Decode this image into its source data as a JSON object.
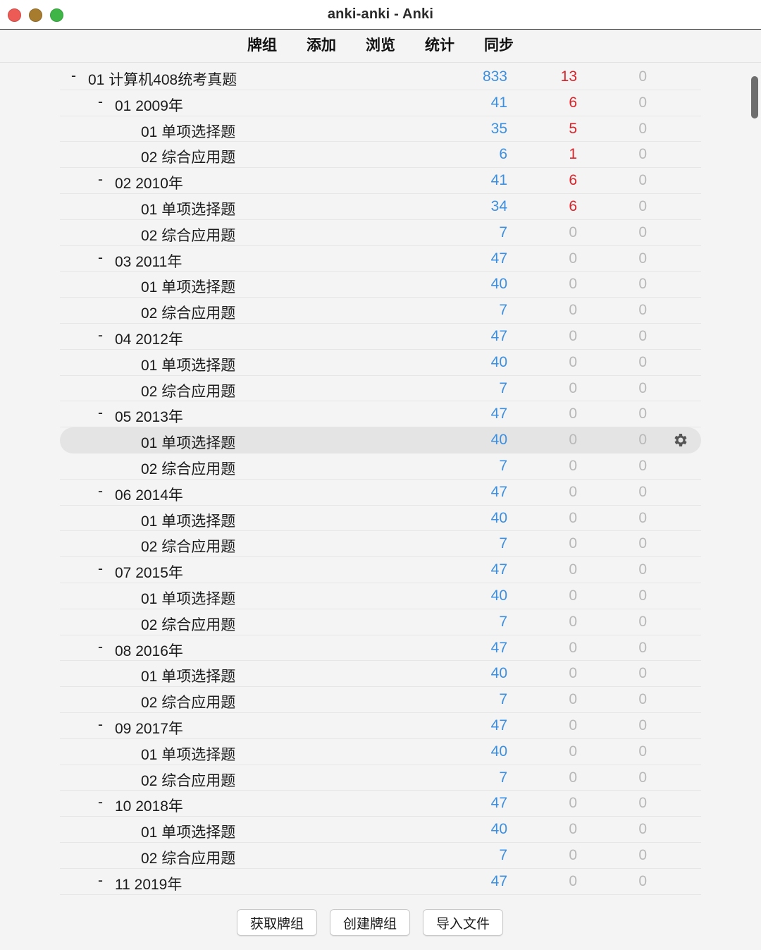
{
  "window": {
    "title": "anki-anki - Anki"
  },
  "toolbar": {
    "tabs": [
      "牌组",
      "添加",
      "浏览",
      "统计",
      "同步"
    ]
  },
  "decks": [
    {
      "name": "01 计算机408统考真题",
      "level": 0,
      "collapse": "-",
      "new": "833",
      "learn": "13",
      "due": "0"
    },
    {
      "name": "01 2009年",
      "level": 1,
      "collapse": "-",
      "new": "41",
      "learn": "6",
      "due": "0"
    },
    {
      "name": "01 单项选择题",
      "level": 2,
      "collapse": "",
      "new": "35",
      "learn": "5",
      "due": "0"
    },
    {
      "name": "02 综合应用题",
      "level": 2,
      "collapse": "",
      "new": "6",
      "learn": "1",
      "due": "0"
    },
    {
      "name": "02 2010年",
      "level": 1,
      "collapse": "-",
      "new": "41",
      "learn": "6",
      "due": "0"
    },
    {
      "name": "01 单项选择题",
      "level": 2,
      "collapse": "",
      "new": "34",
      "learn": "6",
      "due": "0"
    },
    {
      "name": "02 综合应用题",
      "level": 2,
      "collapse": "",
      "new": "7",
      "learn": "0",
      "due": "0"
    },
    {
      "name": "03 2011年",
      "level": 1,
      "collapse": "-",
      "new": "47",
      "learn": "0",
      "due": "0"
    },
    {
      "name": "01 单项选择题",
      "level": 2,
      "collapse": "",
      "new": "40",
      "learn": "0",
      "due": "0"
    },
    {
      "name": "02 综合应用题",
      "level": 2,
      "collapse": "",
      "new": "7",
      "learn": "0",
      "due": "0"
    },
    {
      "name": "04 2012年",
      "level": 1,
      "collapse": "-",
      "new": "47",
      "learn": "0",
      "due": "0"
    },
    {
      "name": "01 单项选择题",
      "level": 2,
      "collapse": "",
      "new": "40",
      "learn": "0",
      "due": "0"
    },
    {
      "name": "02 综合应用题",
      "level": 2,
      "collapse": "",
      "new": "7",
      "learn": "0",
      "due": "0"
    },
    {
      "name": "05 2013年",
      "level": 1,
      "collapse": "-",
      "new": "47",
      "learn": "0",
      "due": "0"
    },
    {
      "name": "01 单项选择题",
      "level": 2,
      "collapse": "",
      "new": "40",
      "learn": "0",
      "due": "0",
      "current": true
    },
    {
      "name": "02 综合应用题",
      "level": 2,
      "collapse": "",
      "new": "7",
      "learn": "0",
      "due": "0"
    },
    {
      "name": "06 2014年",
      "level": 1,
      "collapse": "-",
      "new": "47",
      "learn": "0",
      "due": "0"
    },
    {
      "name": "01 单项选择题",
      "level": 2,
      "collapse": "",
      "new": "40",
      "learn": "0",
      "due": "0"
    },
    {
      "name": "02 综合应用题",
      "level": 2,
      "collapse": "",
      "new": "7",
      "learn": "0",
      "due": "0"
    },
    {
      "name": "07 2015年",
      "level": 1,
      "collapse": "-",
      "new": "47",
      "learn": "0",
      "due": "0"
    },
    {
      "name": "01 单项选择题",
      "level": 2,
      "collapse": "",
      "new": "40",
      "learn": "0",
      "due": "0"
    },
    {
      "name": "02 综合应用题",
      "level": 2,
      "collapse": "",
      "new": "7",
      "learn": "0",
      "due": "0"
    },
    {
      "name": "08 2016年",
      "level": 1,
      "collapse": "-",
      "new": "47",
      "learn": "0",
      "due": "0"
    },
    {
      "name": "01 单项选择题",
      "level": 2,
      "collapse": "",
      "new": "40",
      "learn": "0",
      "due": "0"
    },
    {
      "name": "02 综合应用题",
      "level": 2,
      "collapse": "",
      "new": "7",
      "learn": "0",
      "due": "0"
    },
    {
      "name": "09 2017年",
      "level": 1,
      "collapse": "-",
      "new": "47",
      "learn": "0",
      "due": "0"
    },
    {
      "name": "01 单项选择题",
      "level": 2,
      "collapse": "",
      "new": "40",
      "learn": "0",
      "due": "0"
    },
    {
      "name": "02 综合应用题",
      "level": 2,
      "collapse": "",
      "new": "7",
      "learn": "0",
      "due": "0"
    },
    {
      "name": "10 2018年",
      "level": 1,
      "collapse": "-",
      "new": "47",
      "learn": "0",
      "due": "0"
    },
    {
      "name": "01 单项选择题",
      "level": 2,
      "collapse": "",
      "new": "40",
      "learn": "0",
      "due": "0"
    },
    {
      "name": "02 综合应用题",
      "level": 2,
      "collapse": "",
      "new": "7",
      "learn": "0",
      "due": "0"
    },
    {
      "name": "11 2019年",
      "level": 1,
      "collapse": "-",
      "new": "47",
      "learn": "0",
      "due": "0"
    }
  ],
  "buttons": {
    "get_shared": "获取牌组",
    "create_deck": "创建牌组",
    "import_file": "导入文件"
  },
  "colors": {
    "new_count": "#3d8fe0",
    "learn_count": "#d8242a",
    "zero_count": "#b8b8b8"
  },
  "icons": {
    "options": "gear-icon"
  }
}
